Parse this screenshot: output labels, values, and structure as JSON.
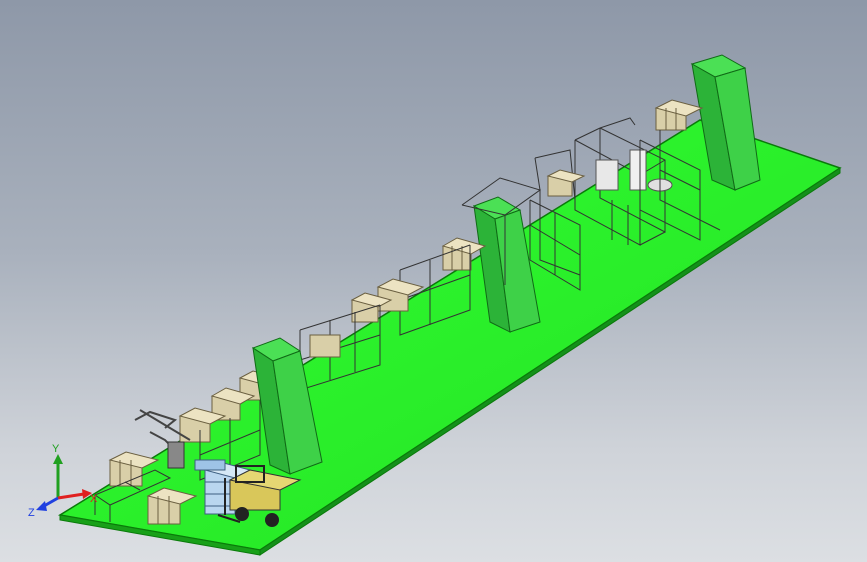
{
  "viewport": {
    "background_top": "#8e98a8",
    "background_bottom": "#dcdfe3",
    "floor_color": "#2df52d",
    "floor_edge_color": "#0a7a0a",
    "column_color": "#2ecc40",
    "frame_color": "#3a3a3a",
    "box_color": "#d9cfa8"
  },
  "triad": {
    "x_label": "X",
    "y_label": "Y",
    "z_label": "Z",
    "x_color": "#e02020",
    "y_color": "#20a020",
    "z_color": "#2040e0"
  }
}
